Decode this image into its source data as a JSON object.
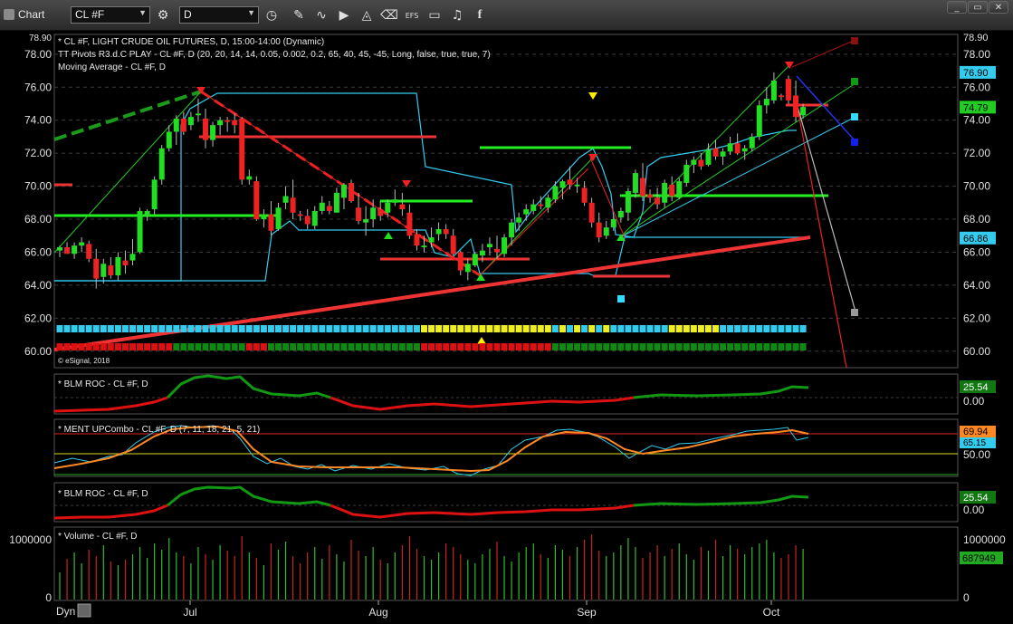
{
  "toolbar": {
    "title": "Chart",
    "symbol": "CL #F",
    "interval": "D",
    "efs_label": "EFS",
    "window_buttons": [
      "_",
      "▭",
      "✕"
    ]
  },
  "colors": {
    "bull": "#22dd22",
    "bear": "#ee2222",
    "cyan": "#33ccee",
    "green_line": "#22ee22",
    "red_line": "#ee3333",
    "orange": "#ff8822",
    "grid": "#3a3a3a"
  },
  "panels": {
    "price": {
      "info_lines": [
        "* CL #F, LIGHT CRUDE OIL FUTURES, D, 15:00-14:00 (Dynamic)",
        "TT Pivots R3.d.C PLAY - CL #F, D (20, 20, 14, 14, 0.05, 0.002, 0.2, 65, 40, 45, -45, Long, false, true, true, 7)",
        "Moving Average - CL #F, D"
      ],
      "copyright": "© eSignal, 2018",
      "top_left_value": "78.90",
      "axis_top_value": "78.90",
      "tags": [
        {
          "label": "76.90",
          "bg": "#33ccee",
          "fg": "#000000",
          "value": 76.9
        },
        {
          "label": "74.79",
          "bg": "#22cc22",
          "fg": "#000000",
          "value": 74.79
        },
        {
          "label": "66.86",
          "bg": "#33ccee",
          "fg": "#000000",
          "value": 66.86
        }
      ]
    },
    "roc1": {
      "label": "* BLM ROC - CL #F, D",
      "tag": "25.54",
      "axis_label": "0.00"
    },
    "ment": {
      "label": "* MENT UPCombo - CL #F, D (7, 11, 18, 21, 5, 21)",
      "tag1": "69.94",
      "tag2": "65.15",
      "axis_label": "50.00"
    },
    "roc2": {
      "label": "* BLM ROC - CL #F, D",
      "tag": "25.54",
      "axis_label": "0.00"
    },
    "volume": {
      "label": "* Volume - CL #F, D",
      "tag": "687949",
      "axis_top": "1000000",
      "axis_zero": "0"
    }
  },
  "bottom_left_label": "Dyn",
  "chart_data": {
    "type": "candlestick",
    "title": "* CL #F, LIGHT CRUDE OIL FUTURES, D, 15:00-14:00 (Dynamic)",
    "ylim": [
      59.0,
      79.2
    ],
    "y_ticks": [
      60,
      62,
      64,
      66,
      68,
      70,
      72,
      74,
      76,
      78
    ],
    "x_labels": [
      "Jul",
      "Aug",
      "Sep",
      "Oct"
    ],
    "candles": [
      [
        66.1,
        66.4,
        65.7,
        66.3
      ],
      [
        66.3,
        66.6,
        65.9,
        65.9
      ],
      [
        65.9,
        66.6,
        65.6,
        66.4
      ],
      [
        66.4,
        66.9,
        66.0,
        66.6
      ],
      [
        66.5,
        66.7,
        65.4,
        65.6
      ],
      [
        65.6,
        66.2,
        63.8,
        64.4
      ],
      [
        64.5,
        65.6,
        64.1,
        65.3
      ],
      [
        65.2,
        65.7,
        64.4,
        64.6
      ],
      [
        64.6,
        66.0,
        64.3,
        65.7
      ],
      [
        65.5,
        66.1,
        64.7,
        65.2
      ],
      [
        65.5,
        66.8,
        65.2,
        65.9
      ],
      [
        66.0,
        68.7,
        65.9,
        68.5
      ],
      [
        68.2,
        68.6,
        67.9,
        68.5
      ],
      [
        68.6,
        70.6,
        68.3,
        70.4
      ],
      [
        70.4,
        72.5,
        70.1,
        72.3
      ],
      [
        72.3,
        73.7,
        72.1,
        73.3
      ],
      [
        73.3,
        74.3,
        72.5,
        74.1
      ],
      [
        74.1,
        74.5,
        73.1,
        73.3
      ],
      [
        73.7,
        74.5,
        73.4,
        74.2
      ],
      [
        74.3,
        75.3,
        73.9,
        74.4
      ],
      [
        74.1,
        74.7,
        72.3,
        72.8
      ],
      [
        72.8,
        73.9,
        72.4,
        73.7
      ],
      [
        73.7,
        74.2,
        73.1,
        74.0
      ],
      [
        74.0,
        74.2,
        73.3,
        73.9
      ],
      [
        74.0,
        74.4,
        73.2,
        73.7
      ],
      [
        74.1,
        74.2,
        70.1,
        70.4
      ],
      [
        70.4,
        71.0,
        70.1,
        70.6
      ],
      [
        70.3,
        70.6,
        67.9,
        68.0
      ],
      [
        68.0,
        68.6,
        67.5,
        68.3
      ],
      [
        68.3,
        69.1,
        67.0,
        67.3
      ],
      [
        67.4,
        69.0,
        67.3,
        68.7
      ],
      [
        69.0,
        70.0,
        68.6,
        69.4
      ],
      [
        69.3,
        70.4,
        68.0,
        68.4
      ],
      [
        68.3,
        68.5,
        67.9,
        68.2
      ],
      [
        68.2,
        68.6,
        67.4,
        67.7
      ],
      [
        67.6,
        68.8,
        67.4,
        68.5
      ],
      [
        68.5,
        69.4,
        68.3,
        69.0
      ],
      [
        68.8,
        69.1,
        68.3,
        68.5
      ],
      [
        68.4,
        69.9,
        68.4,
        69.6
      ],
      [
        69.3,
        70.2,
        68.6,
        70.1
      ],
      [
        70.2,
        70.4,
        69.0,
        69.1
      ],
      [
        68.7,
        69.6,
        67.7,
        67.9
      ],
      [
        67.8,
        68.8,
        67.0,
        68.0
      ],
      [
        68.0,
        69.2,
        67.5,
        68.7
      ],
      [
        68.6,
        69.1,
        67.9,
        68.2
      ],
      [
        68.4,
        69.2,
        68.1,
        69.0
      ],
      [
        69.0,
        69.8,
        68.8,
        69.2
      ],
      [
        68.9,
        69.6,
        68.2,
        68.6
      ],
      [
        68.4,
        68.9,
        66.8,
        67.0
      ],
      [
        67.1,
        67.4,
        66.1,
        66.4
      ],
      [
        66.3,
        67.0,
        66.0,
        66.4
      ],
      [
        66.6,
        67.5,
        66.3,
        66.9
      ],
      [
        67.1,
        67.8,
        66.7,
        67.4
      ],
      [
        67.4,
        67.7,
        66.8,
        67.1
      ],
      [
        67.0,
        67.4,
        65.8,
        65.9
      ],
      [
        66.0,
        66.1,
        64.6,
        64.9
      ],
      [
        64.8,
        65.6,
        64.3,
        65.3
      ],
      [
        65.2,
        66.0,
        65.1,
        65.9
      ],
      [
        65.8,
        66.5,
        65.4,
        66.1
      ],
      [
        66.3,
        66.9,
        65.8,
        66.5
      ],
      [
        66.2,
        67.0,
        65.6,
        66.0
      ],
      [
        65.9,
        67.1,
        65.7,
        66.9
      ],
      [
        66.9,
        68.0,
        66.4,
        67.8
      ],
      [
        67.8,
        68.4,
        67.3,
        68.1
      ],
      [
        68.3,
        68.9,
        67.9,
        68.6
      ],
      [
        68.5,
        69.2,
        68.3,
        68.9
      ],
      [
        68.9,
        69.4,
        68.6,
        68.8
      ],
      [
        68.7,
        69.5,
        68.4,
        69.3
      ],
      [
        69.2,
        70.3,
        69.0,
        70.0
      ],
      [
        69.9,
        70.4,
        69.2,
        70.3
      ],
      [
        70.4,
        71.2,
        69.8,
        70.1
      ],
      [
        70.0,
        70.5,
        69.6,
        70.1
      ],
      [
        69.9,
        70.3,
        68.8,
        69.0
      ],
      [
        69.0,
        69.3,
        67.5,
        67.8
      ],
      [
        67.8,
        68.4,
        66.6,
        66.9
      ],
      [
        67.0,
        67.9,
        66.8,
        67.5
      ],
      [
        67.5,
        68.2,
        67.3,
        68.0
      ],
      [
        68.1,
        68.7,
        67.8,
        68.5
      ],
      [
        68.4,
        69.9,
        67.9,
        69.7
      ],
      [
        69.6,
        71.0,
        69.3,
        70.8
      ],
      [
        70.5,
        71.4,
        69.1,
        69.4
      ],
      [
        69.5,
        69.8,
        69.0,
        69.3
      ],
      [
        69.3,
        69.9,
        68.6,
        68.9
      ],
      [
        69.0,
        70.4,
        68.7,
        70.2
      ],
      [
        70.1,
        70.6,
        69.1,
        69.4
      ],
      [
        69.3,
        70.5,
        69.2,
        70.3
      ],
      [
        70.2,
        71.6,
        70.0,
        71.3
      ],
      [
        71.3,
        71.8,
        70.8,
        71.6
      ],
      [
        71.6,
        72.0,
        71.0,
        71.2
      ],
      [
        71.3,
        72.6,
        71.2,
        72.2
      ],
      [
        72.3,
        72.8,
        71.6,
        71.8
      ],
      [
        71.8,
        72.3,
        71.3,
        72.1
      ],
      [
        72.1,
        73.0,
        71.9,
        72.6
      ],
      [
        72.6,
        73.2,
        71.9,
        72.0
      ],
      [
        72.1,
        72.5,
        71.6,
        72.3
      ],
      [
        72.3,
        73.2,
        72.1,
        73.0
      ],
      [
        73.0,
        75.2,
        72.8,
        74.9
      ],
      [
        74.9,
        76.0,
        74.4,
        75.3
      ],
      [
        75.2,
        76.9,
        75.0,
        76.4
      ],
      [
        75.5,
        75.6,
        75.2,
        75.4
      ],
      [
        76.5,
        76.7,
        75.0,
        75.2
      ],
      [
        75.5,
        76.4,
        73.9,
        74.2
      ],
      [
        74.3,
        75.0,
        74.1,
        74.8
      ]
    ]
  }
}
